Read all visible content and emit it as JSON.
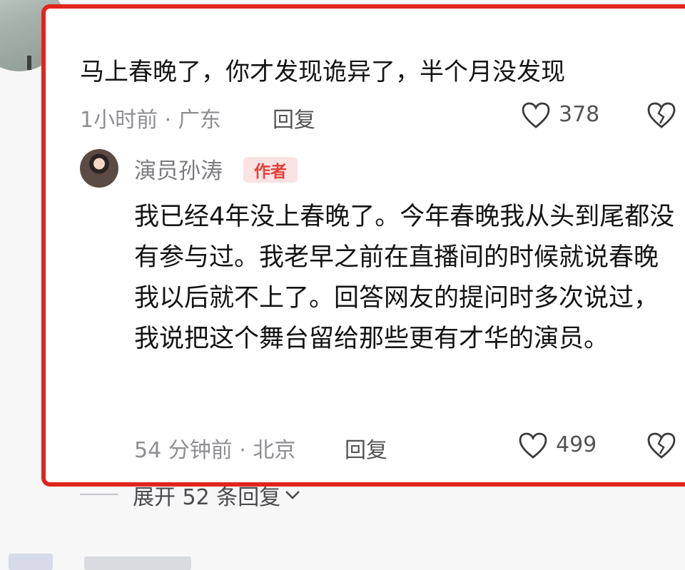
{
  "comment": {
    "text": "马上春晚了，你才发现诡异了，半个月没发现",
    "time_location": "1小时前 · 广东",
    "reply_label": "回复",
    "likes": "378"
  },
  "reply": {
    "author_name": "演员孙涛",
    "author_badge": "作者",
    "text": "我已经4年没上春晚了。今年春晚我从头到尾都没有参与过。我老早之前在直播间的时候就说春晚我以后就不上了。回答网友的提问时多次说过，我说把这个舞台留给那些更有才华的演员。",
    "time_location": "54 分钟前 · 北京",
    "reply_label": "回复",
    "likes": "499"
  },
  "expand_replies_label": "展开 52 条回复",
  "icons": [
    "heart-icon",
    "dislike-broken-heart-icon",
    "chevron-down-icon"
  ],
  "colors": {
    "highlight_border": "#e1241c",
    "badge_bg": "#fbe3e3",
    "badge_text": "#e2403a"
  }
}
